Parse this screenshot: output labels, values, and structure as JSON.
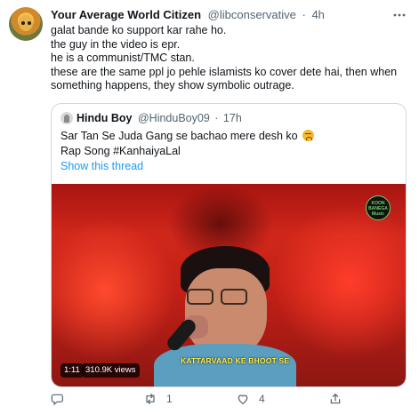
{
  "tweet": {
    "author_name": "Your Average World Citizen",
    "author_handle": "@libconservative",
    "separator": "·",
    "time": "4h",
    "lines": [
      "galat bande ko support kar rahe ho.",
      "the guy in the video is epr.",
      "he is a communist/TMC stan.",
      "these are the same ppl jo pehle islamists ko cover dete hai, then when",
      "something happens, they show symbolic outrage."
    ]
  },
  "quoted": {
    "author_name": "Hindu Boy",
    "author_handle": "@HinduBoy09",
    "separator": "·",
    "time": "17h",
    "line1": "Sar Tan Se Juda Gang se bachao mere desh ko",
    "line2_prefix": "Rap Song ",
    "hashtag": "#KanhaiyaLal",
    "show_thread": "Show this thread",
    "video": {
      "logo_text": "KOON BANEGA Music",
      "caption": "KATTARVAAD KE BHOOT SE",
      "duration": "1:11",
      "views": "310.9K views"
    }
  },
  "actions": {
    "reply_count": "",
    "retweet_count": "1",
    "like_count": "4"
  },
  "colors": {
    "accent": "#1d9bf0",
    "secondary_text": "#536471",
    "border": "#cfd9de"
  },
  "icons": [
    "reply-icon",
    "retweet-icon",
    "like-icon",
    "share-icon",
    "more-icon"
  ]
}
